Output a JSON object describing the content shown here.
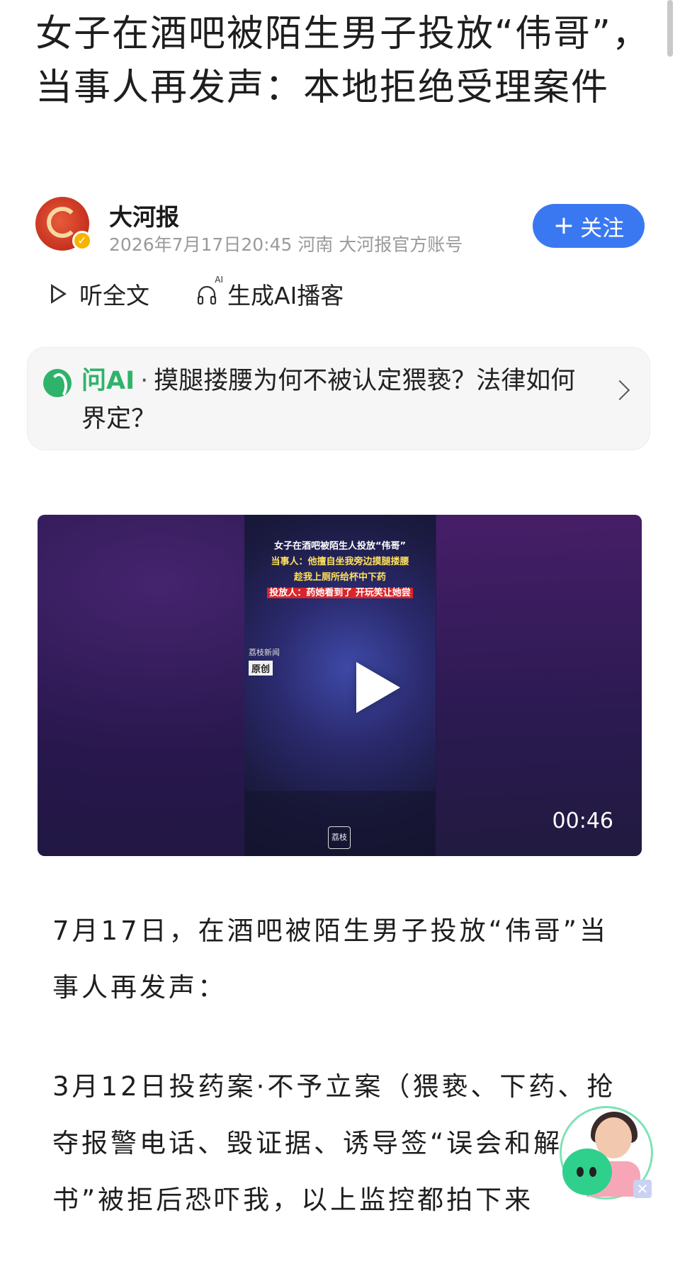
{
  "article": {
    "title": "女子在酒吧被陌生男子投放“伟哥”，当事人再发声：本地拒绝受理案件"
  },
  "author": {
    "name": "大河报",
    "meta": "2026年7月17日20:45 河南 大河报官方账号",
    "follow_label": "关注",
    "follow_icon": "plus-icon",
    "verified_icon": "check-icon"
  },
  "actions": {
    "listen_label": "听全文",
    "podcast_label": "生成AI播客",
    "podcast_icon_badge": "AI"
  },
  "ask_ai": {
    "brand": "问AI",
    "separator": "·",
    "question": "摸腿搂腰为何不被认定猥亵？法律如何界定？"
  },
  "video": {
    "caption_line1": "女子在酒吧被陌生人投放“伟哥”",
    "caption_line2": "当事人：他擅自坐我旁边摸腿搂腰",
    "caption_line3": "趁我上厕所给杯中下药",
    "caption_line4": "投放人：药她看到了 开玩笑让她尝",
    "source_label": "荔枝新闻",
    "original_badge": "原创",
    "logo_text": "荔枝",
    "duration": "00:46"
  },
  "body": {
    "paragraph1": "7月17日，在酒吧被陌生男子投放“伟哥”当事人再发声：",
    "paragraph2": "3月12日投药案·不予立案（猥亵、下药、抢夺报警电话、毁证据、诱导签“误会和解书”被拒后恐吓我，以上监控都拍下来"
  },
  "assistant": {
    "close_label": "✕"
  },
  "colors": {
    "accent_blue": "#3a78f2",
    "ai_green": "#2fb36a",
    "meta_gray": "#9a9a9a"
  }
}
